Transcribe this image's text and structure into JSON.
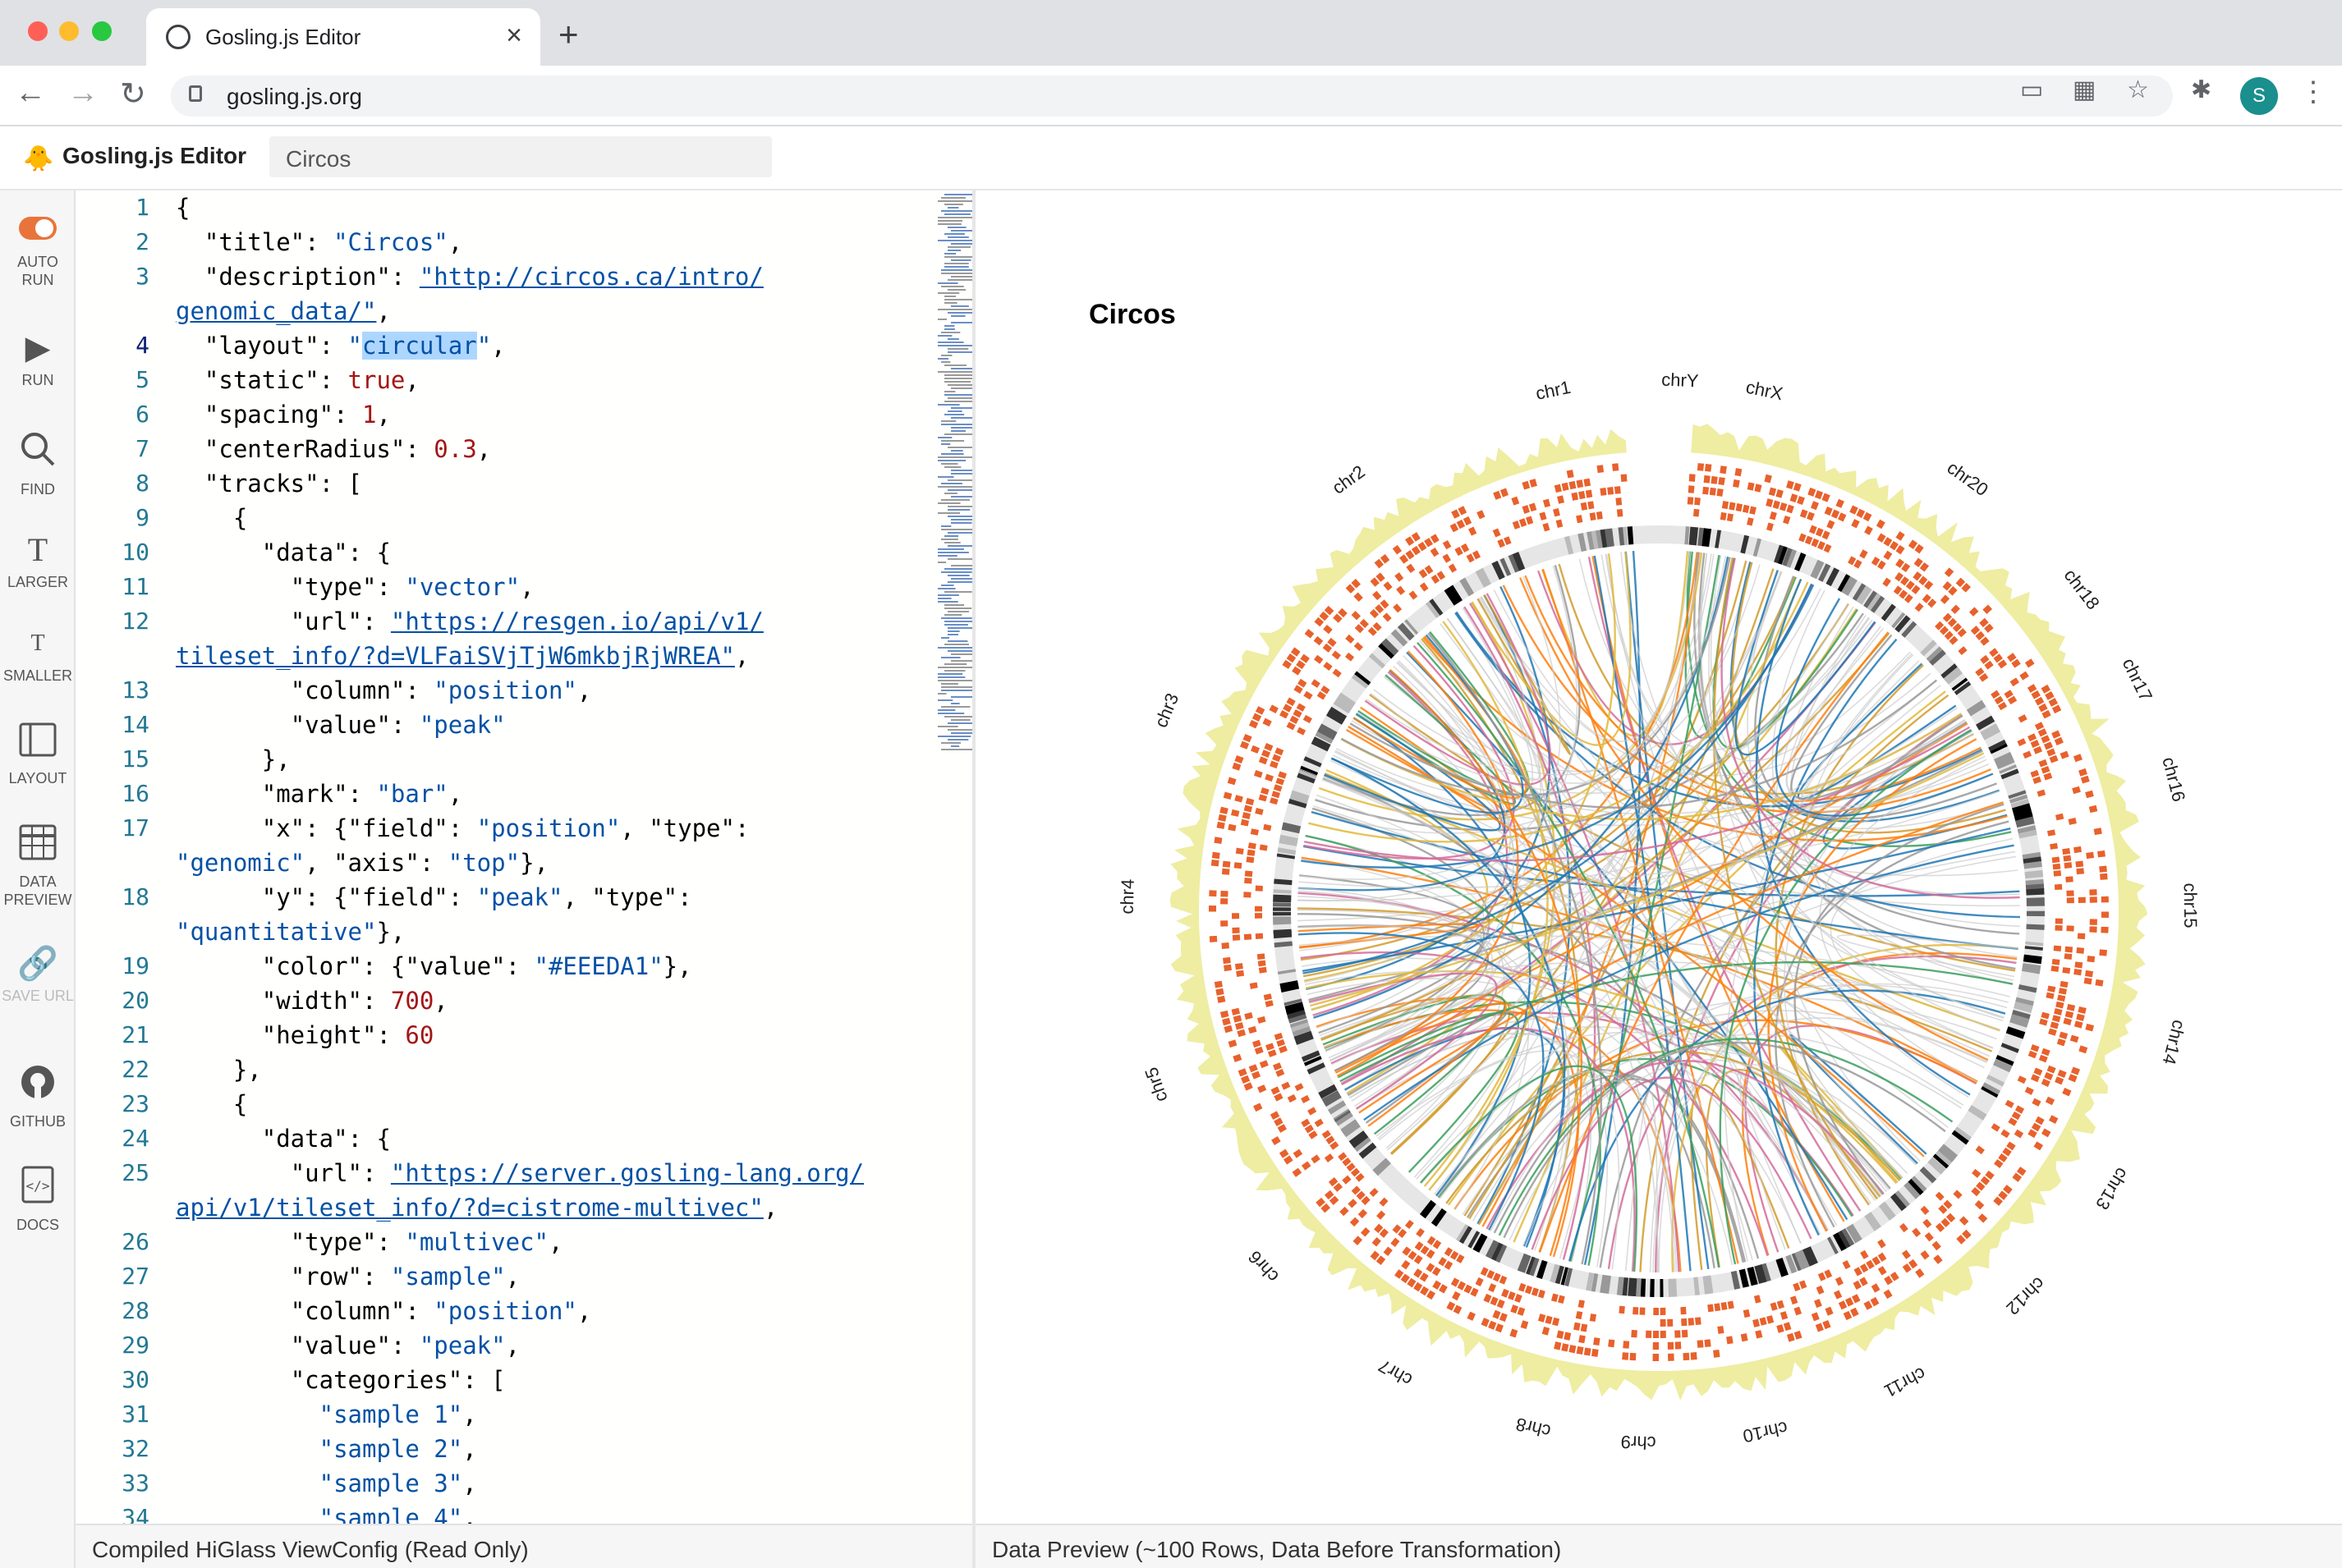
{
  "browser": {
    "tab_title": "Gosling.js Editor",
    "tab_close": "×",
    "new_tab": "+",
    "url": "gosling.js.org",
    "profile_initial": "S"
  },
  "app": {
    "title": "Gosling.js Editor",
    "example": "Circos"
  },
  "sidebar": {
    "auto_run": "AUTO RUN",
    "run": "RUN",
    "find": "FIND",
    "larger": "LARGER",
    "smaller": "SMALLER",
    "layout": "LAYOUT",
    "data_preview": "DATA PREVIEW",
    "save_url": "SAVE URL",
    "github": "GITHUB",
    "docs": "DOCS"
  },
  "editor": {
    "line_numbers": [
      "1",
      "2",
      "3",
      "4",
      "5",
      "6",
      "7",
      "8",
      "9",
      "10",
      "11",
      "12",
      "13",
      "14",
      "15",
      "16",
      "17",
      "18",
      "19",
      "20",
      "21",
      "22",
      "23",
      "24",
      "25",
      "26",
      "27",
      "28",
      "29",
      "30",
      "31",
      "32",
      "33",
      "34"
    ]
  },
  "viz": {
    "title": "Circos",
    "chromosomes": [
      "chr1",
      "chrY",
      "chrX",
      "chr20",
      "chr18",
      "chr17",
      "chr16",
      "chr15",
      "chr14",
      "chr13",
      "chr12",
      "chr11",
      "chr10",
      "chr9",
      "chr8",
      "chr7",
      "chr6",
      "chr5",
      "chr4",
      "chr3",
      "chr2"
    ]
  },
  "panels": {
    "left_bottom": "Compiled HiGlass ViewConfig (Read Only)",
    "right_bottom": "Data Preview (~100 Rows, Data Before Transformation)"
  }
}
